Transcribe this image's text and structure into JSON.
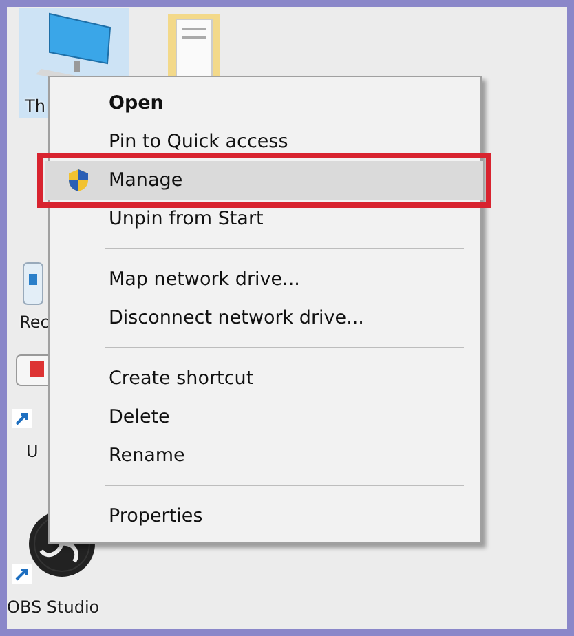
{
  "desktop_icons": [
    {
      "kind": "computer",
      "label": "Th",
      "selected": true,
      "shortcut": false
    },
    {
      "kind": "folder",
      "selected": false,
      "shortcut": false
    },
    {
      "kind": "bin",
      "label": "Rec",
      "selected": false,
      "shortcut": false
    },
    {
      "kind": "app",
      "label": "U",
      "selected": false,
      "shortcut": true
    },
    {
      "kind": "obs",
      "label": "OBS Studio",
      "selected": false,
      "shortcut": true
    }
  ],
  "context_menu": {
    "items": [
      {
        "kind": "item",
        "label": "Open",
        "default": true,
        "selected": false,
        "outlined": false
      },
      {
        "kind": "item",
        "label": "Pin to Quick access",
        "default": false,
        "selected": false,
        "outlined": false
      },
      {
        "kind": "admin",
        "label": "Manage",
        "default": false,
        "selected": true,
        "outlined": true
      },
      {
        "kind": "item",
        "label": "Unpin from Start",
        "default": false,
        "selected": false,
        "outlined": false
      },
      {
        "kind": "separator"
      },
      {
        "kind": "item",
        "label": "Map network drive...",
        "default": false,
        "selected": false,
        "outlined": false
      },
      {
        "kind": "item",
        "label": "Disconnect network drive...",
        "default": false,
        "selected": false,
        "outlined": false
      },
      {
        "kind": "separator"
      },
      {
        "kind": "item",
        "label": "Create shortcut",
        "default": false,
        "selected": false,
        "outlined": false
      },
      {
        "kind": "item",
        "label": "Delete",
        "default": false,
        "selected": false,
        "outlined": false
      },
      {
        "kind": "item",
        "label": "Rename",
        "default": false,
        "selected": false,
        "outlined": false
      },
      {
        "kind": "separator"
      },
      {
        "kind": "item",
        "label": "Properties",
        "default": false,
        "selected": false,
        "outlined": false
      }
    ]
  }
}
